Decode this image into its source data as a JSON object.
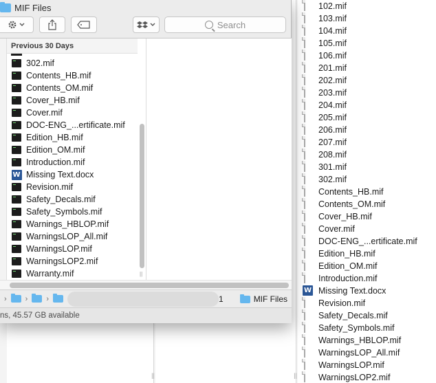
{
  "window": {
    "title": "MIF Files"
  },
  "toolbar": {
    "search_placeholder": "Search",
    "action_icon": "gear-icon",
    "share_icon": "share-icon",
    "tag_icon": "tag-icon",
    "dropbox_icon": "dropbox-icon"
  },
  "sidebar_section": {
    "label": "Previous 30 Days"
  },
  "files": [
    {
      "name": "302.mif",
      "type": "mif"
    },
    {
      "name": "Contents_HB.mif",
      "type": "mif"
    },
    {
      "name": "Contents_OM.mif",
      "type": "mif"
    },
    {
      "name": "Cover_HB.mif",
      "type": "mif"
    },
    {
      "name": "Cover.mif",
      "type": "mif"
    },
    {
      "name": "DOC-ENG_...ertificate.mif",
      "type": "mif"
    },
    {
      "name": "Edition_HB.mif",
      "type": "mif"
    },
    {
      "name": "Edition_OM.mif",
      "type": "mif"
    },
    {
      "name": "Introduction.mif",
      "type": "mif"
    },
    {
      "name": "Missing Text.docx",
      "type": "docx"
    },
    {
      "name": "Revision.mif",
      "type": "mif"
    },
    {
      "name": "Safety_Decals.mif",
      "type": "mif"
    },
    {
      "name": "Safety_Symbols.mif",
      "type": "mif"
    },
    {
      "name": "Warnings_HBLOP.mif",
      "type": "mif"
    },
    {
      "name": "WarningsLOP_All.mif",
      "type": "mif"
    },
    {
      "name": "WarningsLOP.mif",
      "type": "mif"
    },
    {
      "name": "WarningsLOP2.mif",
      "type": "mif"
    },
    {
      "name": "Warranty.mif",
      "type": "mif"
    }
  ],
  "pathbar": {
    "last_segment_prefix": "1",
    "current_folder": "MIF Files"
  },
  "status": {
    "text": "ns, 45.57 GB available"
  },
  "background_list": [
    "102.mif",
    "103.mif",
    "104.mif",
    "105.mif",
    "106.mif",
    "201.mif",
    "202.mif",
    "203.mif",
    "204.mif",
    "205.mif",
    "206.mif",
    "207.mif",
    "208.mif",
    "301.mif",
    "302.mif",
    "Contents_HB.mif",
    "Contents_OM.mif",
    "Cover_HB.mif",
    "Cover.mif",
    "DOC-ENG_...ertificate.mif",
    "Edition_HB.mif",
    "Edition_OM.mif",
    "Introduction.mif",
    "Missing Text.docx",
    "Revision.mif",
    "Safety_Decals.mif",
    "Safety_Symbols.mif",
    "Warnings_HBLOP.mif",
    "WarningsLOP_All.mif",
    "WarningsLOP.mif",
    "WarningsLOP2.mif"
  ]
}
